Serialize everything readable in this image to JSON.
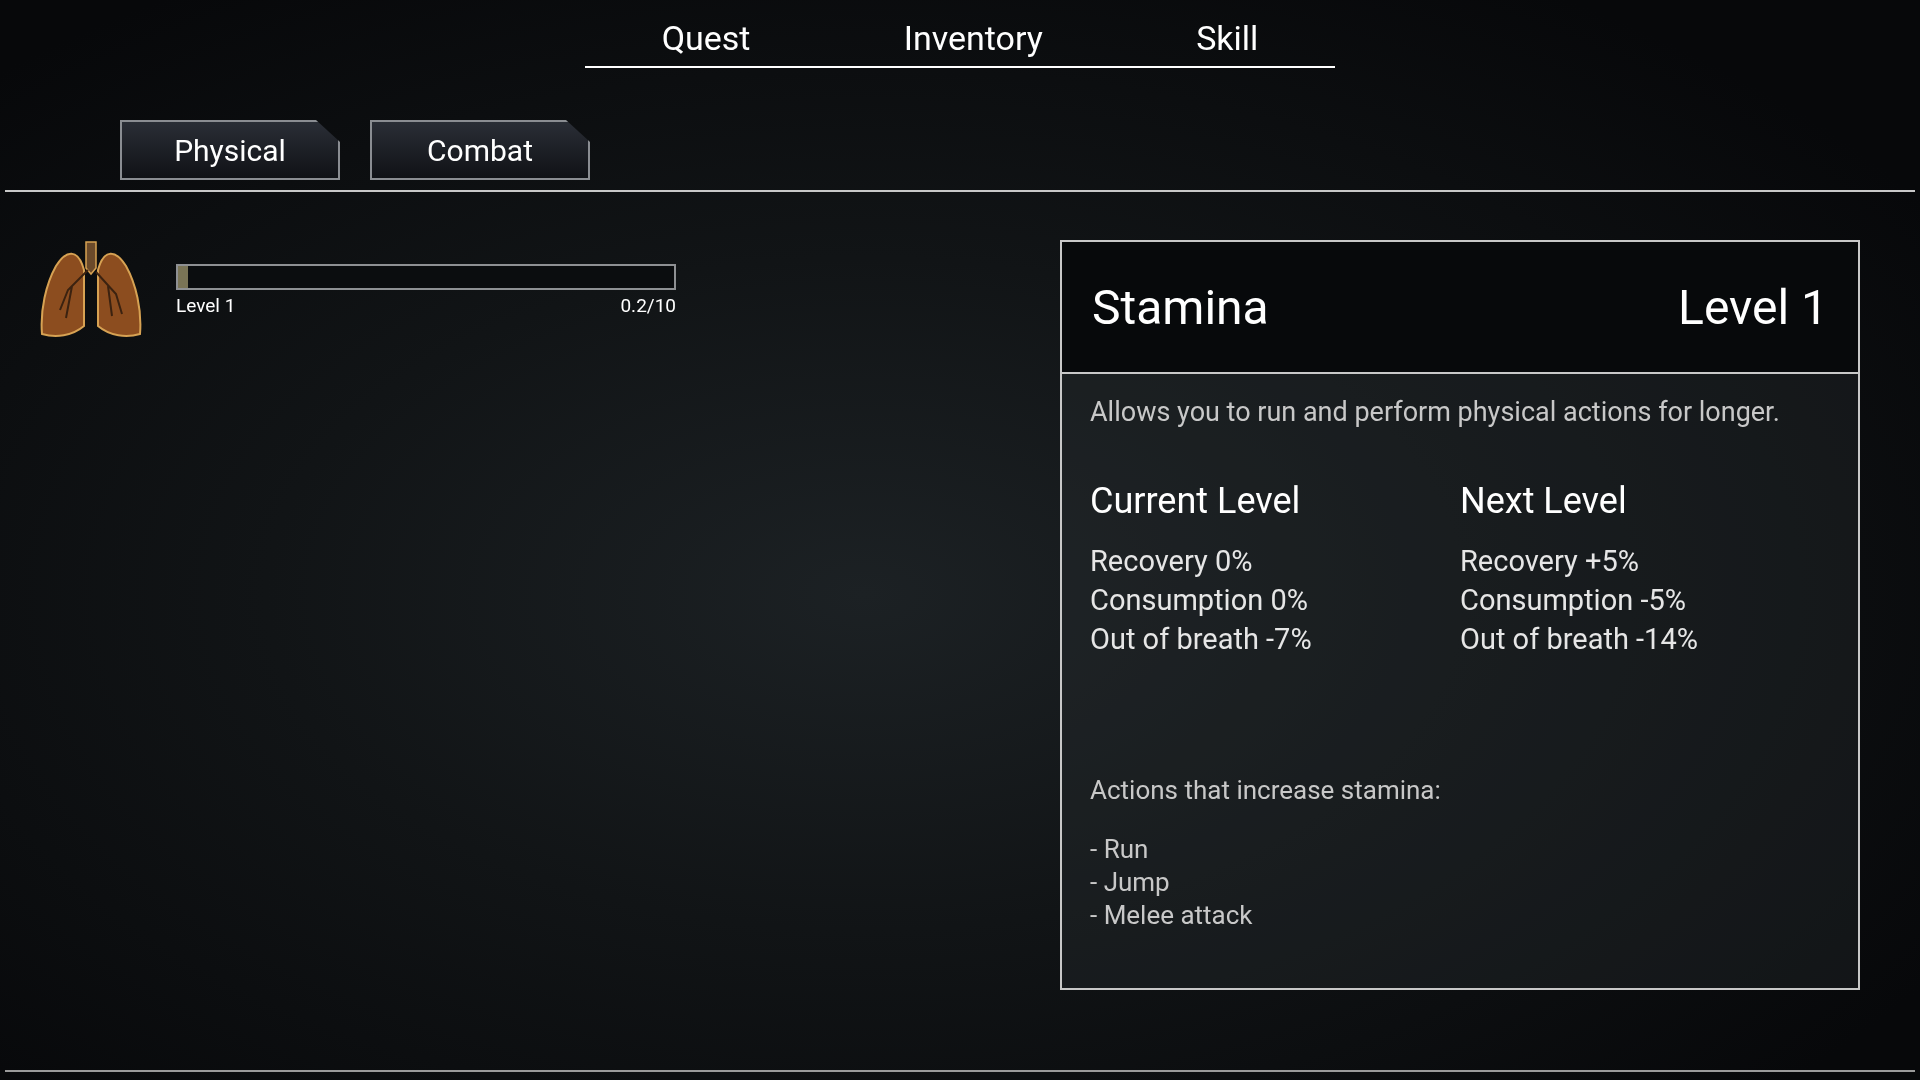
{
  "main_tabs": [
    {
      "label": "Quest"
    },
    {
      "label": "Inventory"
    },
    {
      "label": "Skill"
    }
  ],
  "category_tabs": [
    {
      "label": "Physical"
    },
    {
      "label": "Combat"
    }
  ],
  "skills": [
    {
      "level_label": "Level 1",
      "progress": "0.2/10",
      "level": 0.02
    }
  ],
  "detail": {
    "title": "Stamina",
    "level": "Level 1",
    "description": "Allows you to run and perform physical actions for longer.",
    "columns": [
      {
        "heading": "Current Level",
        "lines": [
          "Recovery 0%",
          "Consumption 0%",
          "Out of breath -7%"
        ]
      },
      {
        "heading": "Next Level",
        "lines": [
          "Recovery +5%",
          "Consumption -5%",
          "Out of breath -14%"
        ]
      }
    ],
    "actions_heading": "Actions that increase stamina:",
    "actions": [
      "- Run",
      "- Jump",
      "- Melee attack"
    ]
  }
}
